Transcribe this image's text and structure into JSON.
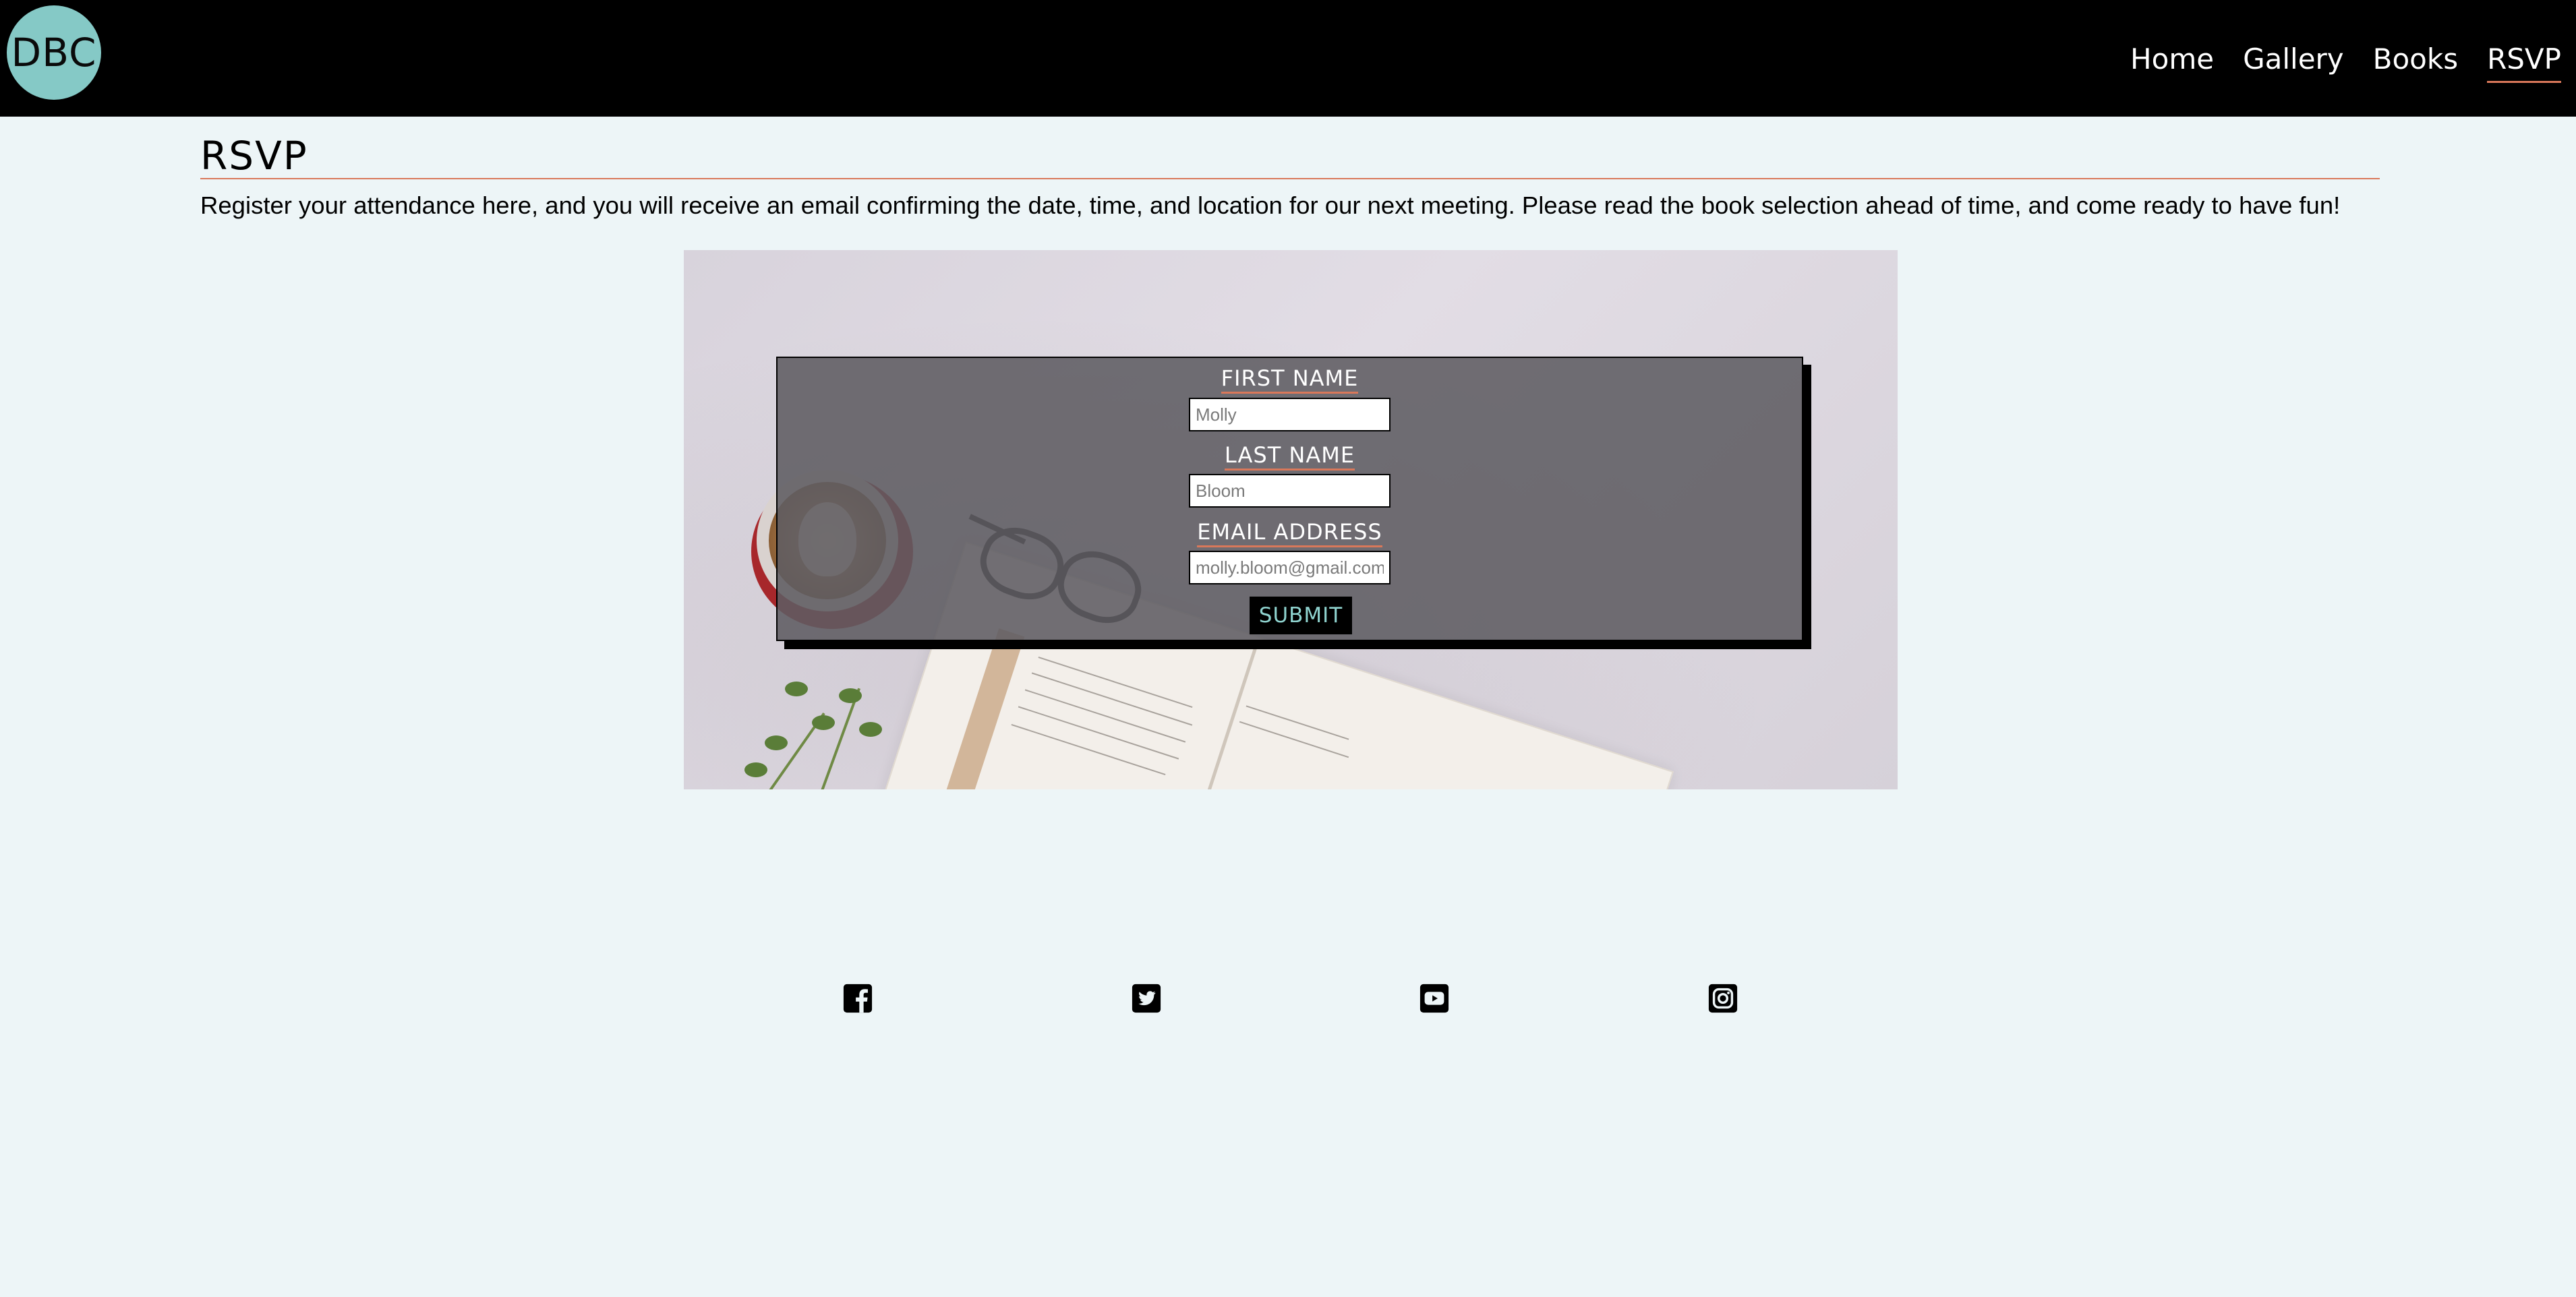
{
  "header": {
    "logo_text": "DBC",
    "nav": [
      {
        "label": "Home"
      },
      {
        "label": "Gallery"
      },
      {
        "label": "Books"
      },
      {
        "label": "RSVP",
        "active": true
      }
    ]
  },
  "page": {
    "title": "RSVP",
    "intro": "Register your attendance here, and you will receive an email confirming the date, time, and location for our next meeting. Please read the book selection ahead of time, and come ready to have fun!"
  },
  "form": {
    "first_name_label": "FIRST NAME",
    "first_name_placeholder": "Molly",
    "last_name_label": "LAST NAME",
    "last_name_placeholder": "Bloom",
    "email_label": "EMAIL ADDRESS",
    "email_placeholder": "molly.bloom@gmail.com",
    "submit_label": "SUBMIT"
  },
  "footer": {
    "social": [
      {
        "icon": "facebook-icon"
      },
      {
        "icon": "twitter-icon"
      },
      {
        "icon": "youtube-icon"
      },
      {
        "icon": "instagram-icon"
      }
    ]
  },
  "colors": {
    "page_background": "#edf5f7",
    "header_background": "#000000",
    "logo_circle": "#85c9c6",
    "accent_underline": "#d9785a",
    "submit_text": "#8fd3cf"
  }
}
